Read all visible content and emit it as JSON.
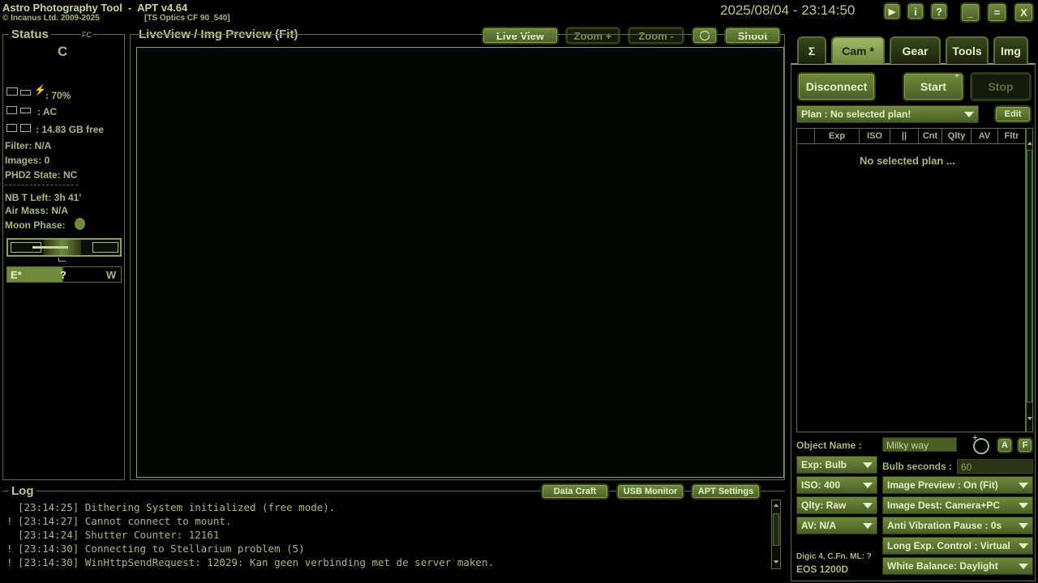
{
  "header": {
    "app_title": "Astro Photography Tool  -  APT v4.64",
    "copyright": "© Incanus Ltd. 2009-2025",
    "scope": "[TS Optics CF 90_540]",
    "datetime": "2025/08/04 - 23:14:50",
    "play_icon": "▶",
    "info_icon": "i",
    "help_icon": "?",
    "min_icon": "_",
    "max_icon": "=",
    "close_icon": "X"
  },
  "status": {
    "title": "Status",
    "fc": "FC",
    "c_label": "C",
    "power": ": 70%",
    "ac": ": AC",
    "disk": ": 14.83 GB free",
    "filter": "Filter: N/A",
    "images": "Images: 0",
    "phd2": "PHD2 State: NC",
    "nb_left": "NB T Left: 3h 41'",
    "air_mass": "Air Mass: N/A",
    "moon_phase": "Moon Phase:",
    "east": "E*",
    "q": "?",
    "west": "W"
  },
  "preview": {
    "title": "LiveView / Img Preview (Fit)",
    "live_view": "Live View",
    "zoom_in": "Zoom +",
    "zoom_out": "Zoom -",
    "shoot": "Shoot"
  },
  "log": {
    "title": "Log",
    "data_craft": "Data Craft",
    "usb_monitor": "USB Monitor",
    "apt_settings": "APT Settings",
    "lines": [
      {
        "mark": " ",
        "text": "[23:14:25] Dithering System initialized (free mode)."
      },
      {
        "mark": "!",
        "text": "[23:14:27] Cannot connect to mount."
      },
      {
        "mark": " ",
        "text": "[23:14:24] Shutter Counter: 12161"
      },
      {
        "mark": "!",
        "text": "[23:14:30] Connecting to Stellarium problem (5)"
      },
      {
        "mark": "!",
        "text": "[23:14:30] WinHttpSendRequest: 12029: Kan geen verbinding met de server maken."
      }
    ]
  },
  "tabs": [
    "Σ",
    "Cam *",
    "Gear",
    "Tools",
    "Img"
  ],
  "cam": {
    "disconnect": "Disconnect",
    "start": "Start",
    "stop": "Stop",
    "plan": "Plan : No selected plan!",
    "edit": "Edit",
    "plan_columns": [
      "Exp",
      "ISO",
      "||",
      "Cnt",
      "Qlty",
      "AV",
      "Fltr"
    ],
    "no_plan": "No selected plan ...",
    "object_name_label": "Object Name :",
    "object_name": "Milky way",
    "a_btn": "A",
    "f_btn": "F",
    "exp": "Exp: Bulb",
    "bulb_label": "Bulb seconds :",
    "bulb_value": "60",
    "iso": "ISO: 400",
    "image_preview": "Image Preview : On (Fit)",
    "qlty": "Qlty: Raw",
    "image_dest": "Image Dest: Camera+PC",
    "av": "AV: N/A",
    "anti_vibration": "Anti Vibration Pause : 0s",
    "long_exp": "Long Exp. Control : Virtual",
    "white_balance": "White Balance: Daylight",
    "digic": "Digic 4, C.Fn. ML: ?",
    "camera_model": "EOS 1200D"
  }
}
